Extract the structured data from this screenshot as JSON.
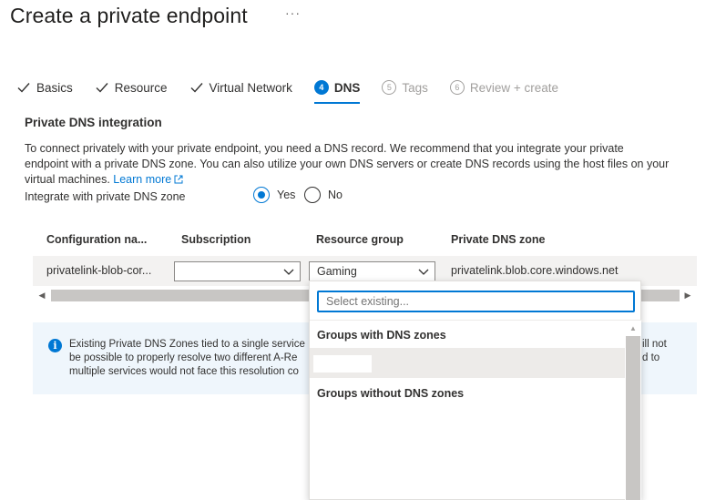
{
  "header": {
    "title": "Create a private endpoint",
    "more_label": "···"
  },
  "tabs": [
    {
      "label": "Basics",
      "state": "done"
    },
    {
      "label": "Resource",
      "state": "done"
    },
    {
      "label": "Virtual Network",
      "state": "done"
    },
    {
      "label": "DNS",
      "state": "active",
      "step": "4"
    },
    {
      "label": "Tags",
      "state": "disabled",
      "step": "5"
    },
    {
      "label": "Review + create",
      "state": "disabled",
      "step": "6"
    }
  ],
  "dns": {
    "heading": "Private DNS integration",
    "description_line1": "To connect privately with your private endpoint, you need a DNS record. We recommend that you integrate your private",
    "description_line2": "endpoint with a private DNS zone. You can also utilize your own DNS servers or create DNS records using the host files on your",
    "description_line3": "virtual machines.",
    "learn_more": "Learn more",
    "integrate_label": "Integrate with private DNS zone",
    "yes_label": "Yes",
    "no_label": "No",
    "selected": "Yes"
  },
  "grid": {
    "columns": [
      "Configuration na...",
      "Subscription",
      "Resource group",
      "Private DNS zone"
    ],
    "row": {
      "configuration": "privatelink-blob-cor...",
      "subscription": "",
      "resource_group": "Gaming",
      "private_dns_zone": "privatelink.blob.core.windows.net"
    }
  },
  "info": {
    "line1_left": "Existing Private DNS Zones tied to a single service",
    "line2_left": "be possible to properly resolve two different A-Re",
    "line3_left": "multiple services would not face this resolution co",
    "line1_right": "ill not",
    "line2_right": "d to"
  },
  "dropdown": {
    "placeholder": "Select existing...",
    "group1": "Groups with DNS zones",
    "group2": "Groups without DNS zones"
  },
  "colors": {
    "accent": "#0078d4",
    "info_bg": "#eff6fc",
    "row_bg": "#f3f2f1"
  }
}
